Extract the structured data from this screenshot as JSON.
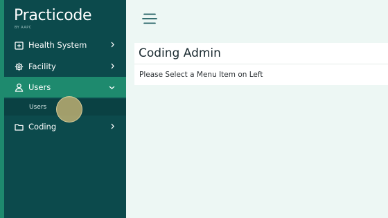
{
  "brand": {
    "name": "Practicode",
    "tagline": "BY AAPC"
  },
  "sidebar": {
    "items": [
      {
        "label": "Health System",
        "icon": "hospital-icon",
        "expanded": false
      },
      {
        "label": "Facility",
        "icon": "gear-icon",
        "expanded": false
      },
      {
        "label": "Users",
        "icon": "user-icon",
        "expanded": true,
        "active": true,
        "children": [
          {
            "label": "Users"
          }
        ]
      },
      {
        "label": "Coding",
        "icon": "folder-icon",
        "expanded": false
      }
    ]
  },
  "header": {
    "menu_icon": "hamburger-icon"
  },
  "main": {
    "title": "Coding Admin",
    "message": "Please Select a Menu Item on Left"
  },
  "colors": {
    "sidebar_bg": "#0c4a4c",
    "accent": "#1e8a6e",
    "page_bg": "#edf7f4"
  }
}
